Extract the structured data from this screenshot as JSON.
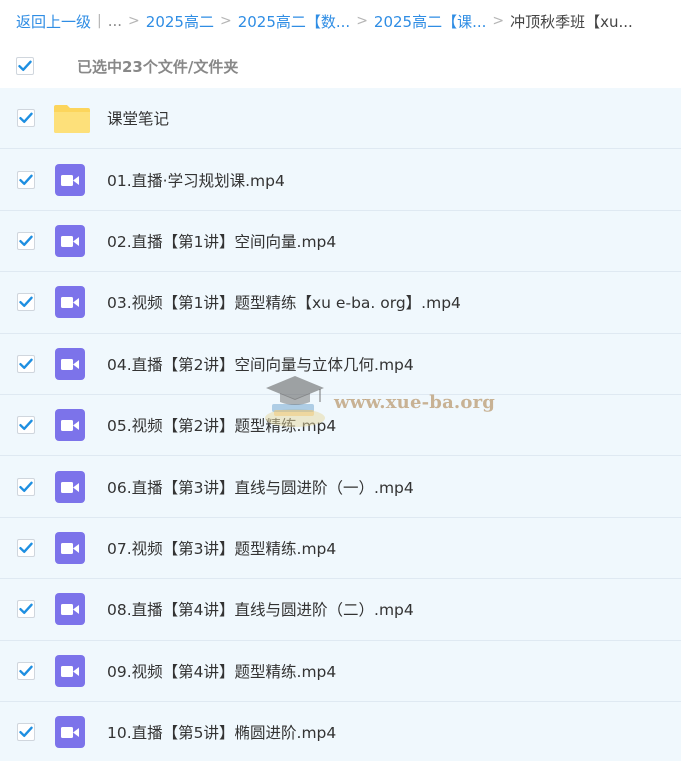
{
  "breadcrumb": {
    "back": "返回上一级",
    "ellipsis": "...",
    "items": [
      {
        "label": "2025高二"
      },
      {
        "label": "2025高二【数..."
      },
      {
        "label": "2025高二【课..."
      }
    ],
    "current": "冲顶秋季班【xu..."
  },
  "selection": {
    "label": "已选中23个文件/文件夹",
    "checked": true
  },
  "files": [
    {
      "name": "课堂笔记",
      "type": "folder",
      "checked": true
    },
    {
      "name": "01.直播·学习规划课.mp4",
      "type": "video",
      "checked": true
    },
    {
      "name": "02.直播【第1讲】空间向量.mp4",
      "type": "video",
      "checked": true
    },
    {
      "name": "03.视频【第1讲】题型精练【xu e-ba. org】.mp4",
      "type": "video",
      "checked": true
    },
    {
      "name": "04.直播【第2讲】空间向量与立体几何.mp4",
      "type": "video",
      "checked": true
    },
    {
      "name": "05.视频【第2讲】题型精练.mp4",
      "type": "video",
      "checked": true
    },
    {
      "name": "06.直播【第3讲】直线与圆进阶（一）.mp4",
      "type": "video",
      "checked": true
    },
    {
      "name": "07.视频【第3讲】题型精练.mp4",
      "type": "video",
      "checked": true
    },
    {
      "name": "08.直播【第4讲】直线与圆进阶（二）.mp4",
      "type": "video",
      "checked": true
    },
    {
      "name": "09.视频【第4讲】题型精练.mp4",
      "type": "video",
      "checked": true
    },
    {
      "name": "10.直播【第5讲】椭圆进阶.mp4",
      "type": "video",
      "checked": true
    }
  ],
  "watermark": {
    "text": "www.xue-ba.org"
  },
  "colors": {
    "link": "#2f8de4",
    "check": "#1e8fe1",
    "row_bg": "#f0f8fd",
    "video_icon": "#7c73ea",
    "folder_icon": "#fcd55c"
  }
}
